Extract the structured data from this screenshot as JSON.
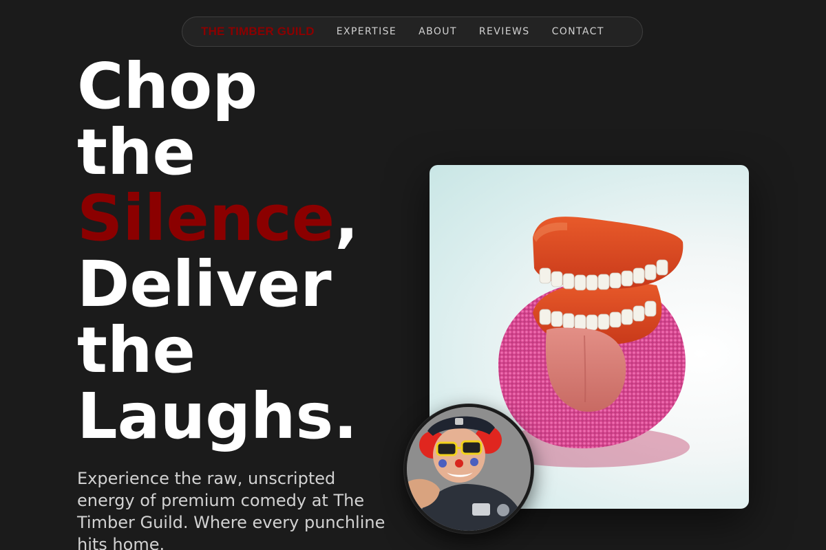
{
  "nav": {
    "logo": "THE TIMBER GUILD",
    "links": [
      "EXPERTISE",
      "ABOUT",
      "REVIEWS",
      "CONTACT"
    ]
  },
  "hero": {
    "headline": {
      "line1": "Chop",
      "line2": "the",
      "line3_accent": "Silence",
      "line3_tail": ",",
      "line4": "Deliver",
      "line5": "the",
      "line6": "Laughs."
    },
    "subcopy": "Experience the raw, unscripted energy of premium comedy at The Timber Guild. Where every punchline hits home."
  },
  "images": {
    "main": "chattering-teeth-toy-photo",
    "inset": "clown-police-officer-photo"
  },
  "colors": {
    "background": "#1b1b1b",
    "accent": "#8b0000",
    "text": "#ffffff",
    "muted_text": "#d2d2d2"
  }
}
